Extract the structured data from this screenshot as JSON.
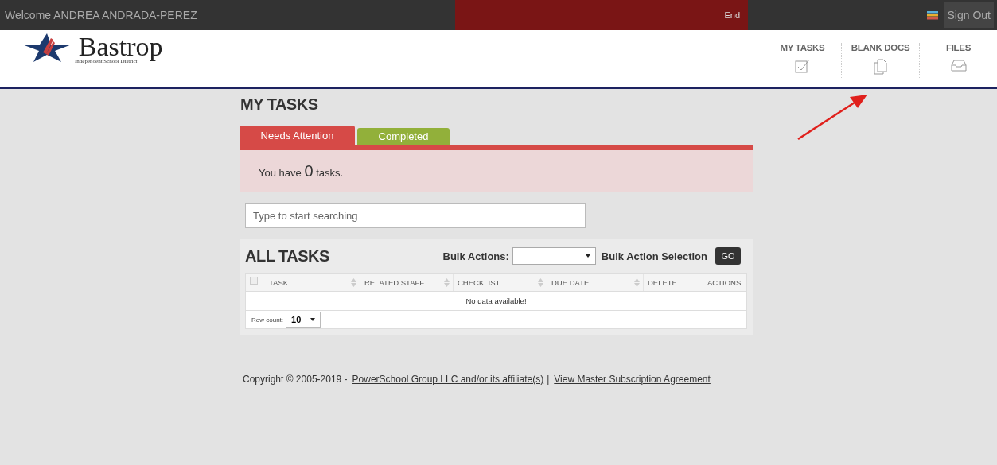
{
  "top_bar": {
    "welcome": "Welcome ANDREA ANDRADA-PEREZ",
    "banner": {
      "action": "End"
    },
    "sign_out": "Sign Out"
  },
  "logo": {
    "name": "Bastrop",
    "subtitle": "Independent School District"
  },
  "nav": [
    {
      "label": "MY TASKS",
      "kind": "check"
    },
    {
      "label": "BLANK DOCS",
      "kind": "docs"
    },
    {
      "label": "FILES",
      "kind": "tray"
    }
  ],
  "page_title": "MY TASKS",
  "tabs": [
    {
      "label": "Needs Attention",
      "selected": true,
      "color": "#d64a47"
    },
    {
      "label": "Completed",
      "selected": false,
      "color": "#92b03a"
    }
  ],
  "notice": {
    "before": "You have",
    "count": "0",
    "after": "tasks."
  },
  "search": {
    "placeholder": "Type to start searching"
  },
  "all_tasks": {
    "title": "ALL TASKS",
    "bulk_label": "Bulk Actions:",
    "bulk_selection": "Bulk Action Selection",
    "go": "GO",
    "select_all_checked": false,
    "columns": [
      {
        "label": "TASK",
        "sortable": true
      },
      {
        "label": "RELATED STAFF",
        "sortable": true
      },
      {
        "label": "CHECKLIST",
        "sortable": true
      },
      {
        "label": "DUE DATE",
        "sortable": true
      },
      {
        "label": "DELETE",
        "sortable": false
      },
      {
        "label": "ACTIONS",
        "sortable": false
      }
    ],
    "empty": "No data available!",
    "row_count_label": "Row count:",
    "row_count": "10"
  },
  "footer": {
    "copyright": "Copyright © 2005-2019 -",
    "link1": "PowerSchool Group LLC and/or its affiliate(s)",
    "separator": "|",
    "link2": "View Master Subscription Agreement"
  }
}
